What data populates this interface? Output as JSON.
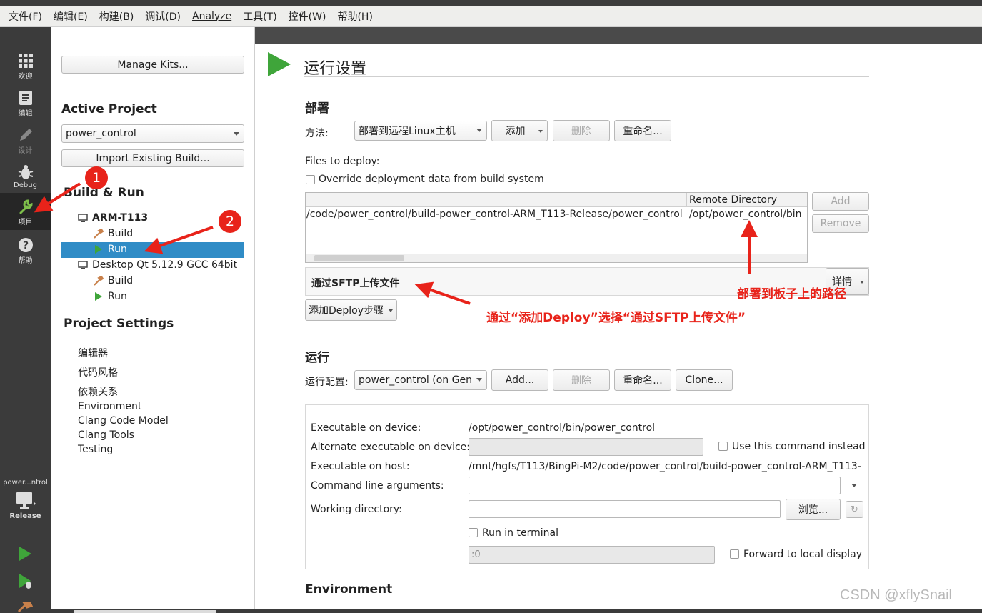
{
  "menubar": {
    "items": [
      "文件(F)",
      "编辑(E)",
      "构建(B)",
      "调试(D)",
      "Analyze",
      "工具(T)",
      "控件(W)",
      "帮助(H)"
    ]
  },
  "modes": [
    {
      "icon": "grid-icon",
      "label": "欢迎"
    },
    {
      "icon": "document-icon",
      "label": "编辑"
    },
    {
      "icon": "pencil-icon",
      "label": "设计"
    },
    {
      "icon": "bug-icon",
      "label": "Debug"
    },
    {
      "icon": "wrench-icon",
      "label": "项目"
    },
    {
      "icon": "help-icon",
      "label": "帮助"
    }
  ],
  "kit_selector": {
    "project": "power...ntrol",
    "config": "Release"
  },
  "left": {
    "manage_kits": "Manage Kits...",
    "active_project_heading": "Active Project",
    "project_value": "power_control",
    "import_build": "Import Existing Build...",
    "build_run_heading": "Build & Run",
    "kits": [
      {
        "name": "ARM-T113",
        "build": "Build",
        "run": "Run"
      },
      {
        "name": "Desktop Qt 5.12.9 GCC 64bit",
        "build": "Build",
        "run": "Run"
      }
    ],
    "project_settings_heading": "Project Settings",
    "settings": [
      "编辑器",
      "代码风格",
      "依赖关系",
      "Environment",
      "Clang Code Model",
      "Clang Tools",
      "Testing"
    ]
  },
  "main": {
    "title": "运行设置",
    "deploy": {
      "heading": "部署",
      "method_label": "方法:",
      "method_value": "部署到远程Linux主机",
      "add": "添加",
      "delete": "删除",
      "rename": "重命名...",
      "files_label": "Files to deploy:",
      "override_label": "Override deployment data from build system",
      "table_header_remote": "Remote Directory",
      "row_local": "/code/power_control/build-power_control-ARM_T113-Release/power_control",
      "row_remote": "/opt/power_control/bin",
      "table_add": "Add",
      "table_remove": "Remove",
      "step_title": "通过SFTP上传文件",
      "details": "详情",
      "add_deploy_step": "添加Deploy步骤"
    },
    "run": {
      "heading": "运行",
      "config_label": "运行配置:",
      "config_value": "power_control (on Gen",
      "add": "Add...",
      "delete": "删除",
      "rename": "重命名...",
      "clone": "Clone...",
      "exe_device_label": "Executable on device:",
      "exe_device_value": "/opt/power_control/bin/power_control",
      "alt_exe_label": "Alternate executable on device:",
      "use_cmd_label": "Use this command instead",
      "exe_host_label": "Executable on host:",
      "exe_host_value": "/mnt/hgfs/T113/BingPi-M2/code/power_control/build-power_control-ARM_T113-",
      "cmd_args_label": "Command line arguments:",
      "workdir_label": "Working directory:",
      "browse": "浏览...",
      "run_terminal_label": "Run in terminal",
      "display_value": ":0",
      "forward_display_label": "Forward to local display"
    },
    "env_heading": "Environment"
  },
  "annotations": {
    "badge1": "1",
    "badge2": "2",
    "path_note": "部署到板子上的路径",
    "deploy_note": "通过“添加Deploy”选择“通过SFTP上传文件”"
  },
  "watermark": "CSDN @xflySnail",
  "colors": {
    "selection": "#308cc6",
    "annotation": "#e8231a",
    "modebar": "#3b3b3b",
    "run_green": "#3fa53a"
  }
}
